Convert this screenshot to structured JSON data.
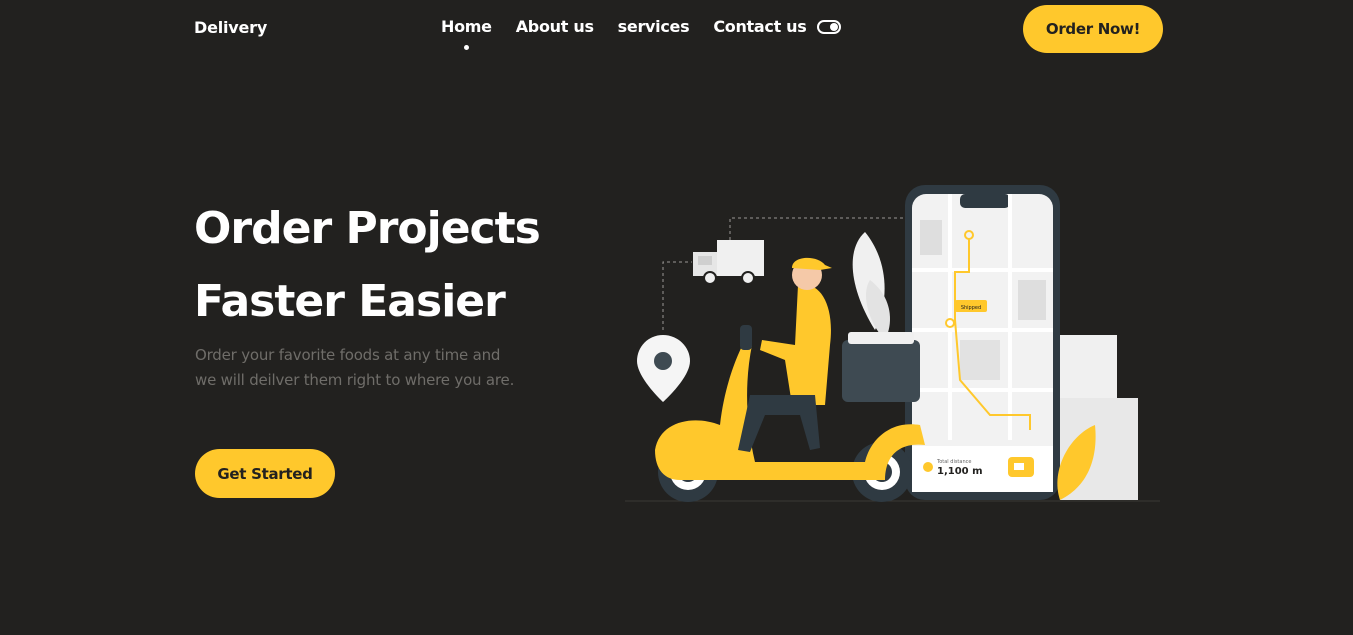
{
  "header": {
    "logo": "Delivery",
    "nav": [
      {
        "label": "Home",
        "active": true
      },
      {
        "label": "About us"
      },
      {
        "label": "services"
      },
      {
        "label": "Contact us"
      }
    ],
    "theme_toggle_icon": "toggle-icon",
    "order_button": "Order Now!"
  },
  "hero": {
    "title_line1": "Order Projects",
    "title_line2": "Faster Easier",
    "description": "Order your favorite foods at any time and we will deilver them right to where you are.",
    "cta": "Get Started"
  },
  "illustration": {
    "phone_label_small": "Total distance",
    "phone_distance": "1,100 m",
    "map_tag": "Shipped"
  },
  "colors": {
    "background": "#22211f",
    "accent": "#ffc82c",
    "text": "#ffffff",
    "muted": "#6f6d69"
  }
}
